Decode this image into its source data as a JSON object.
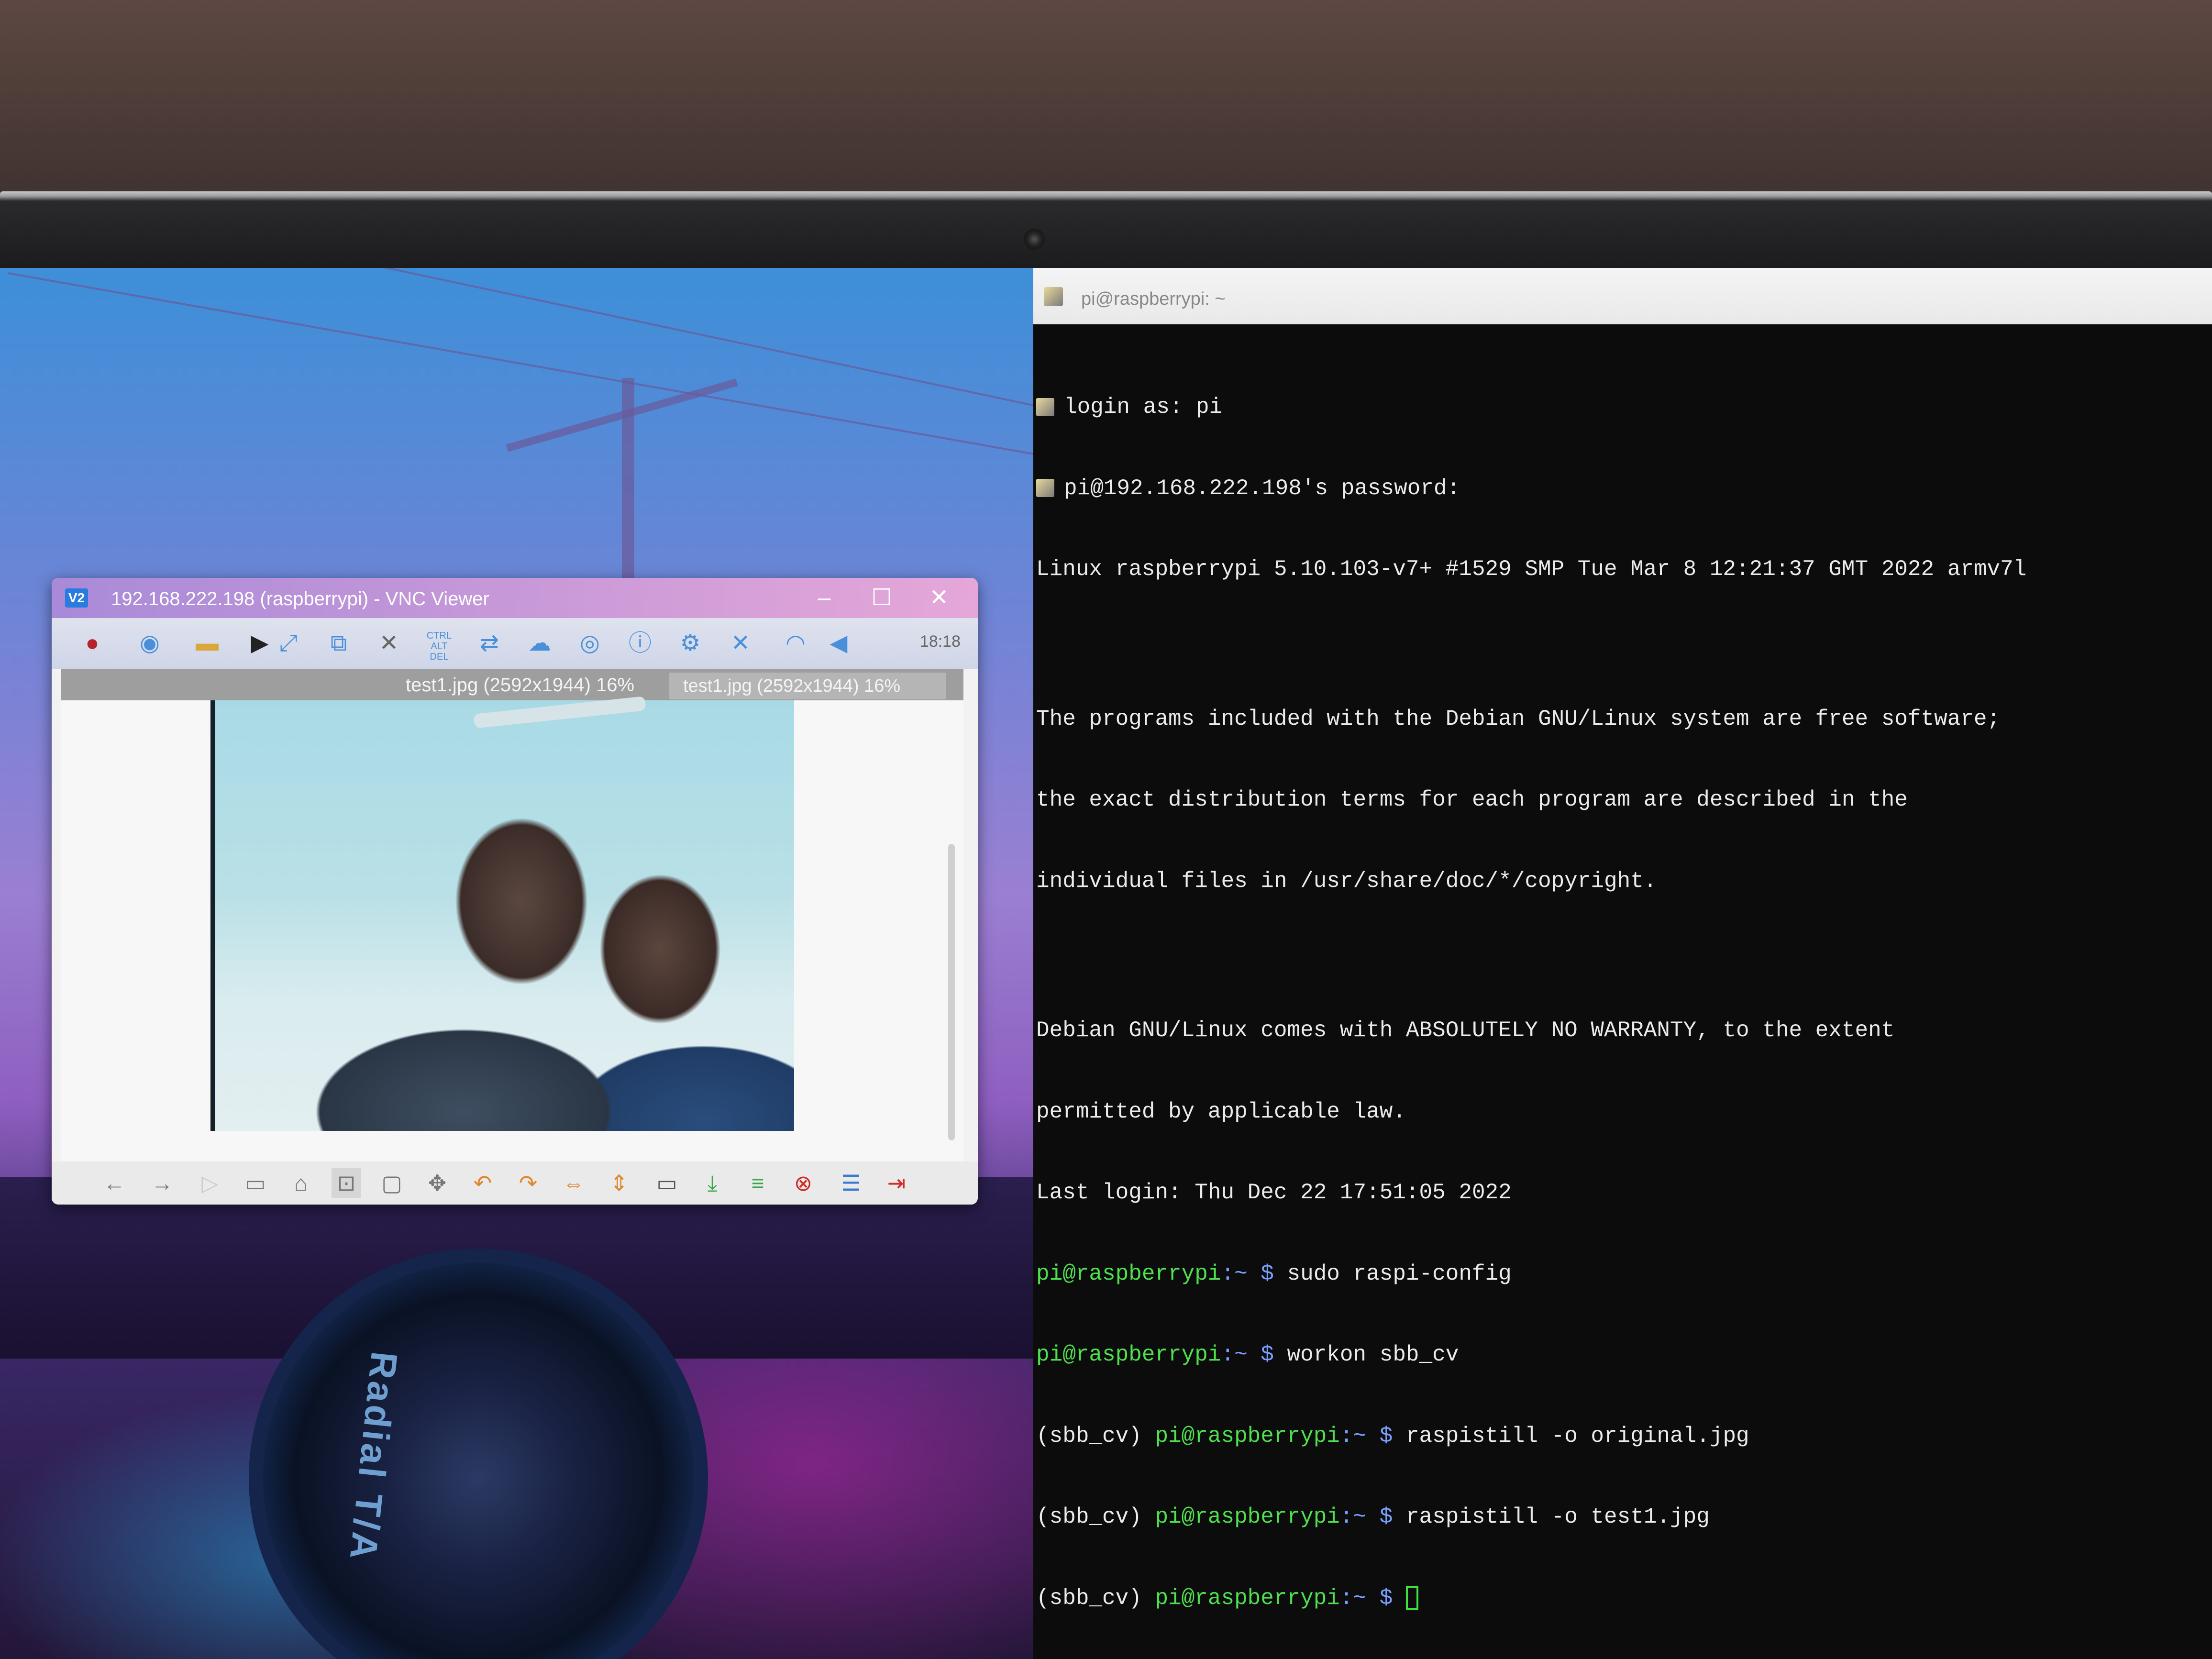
{
  "vnc_viewer": {
    "title": "192.168.222.198 (raspberrypi) - VNC Viewer",
    "logo": "V2",
    "minimize": "–",
    "maximize": "☐",
    "close": "✕",
    "toolbar": {
      "icons": [
        "raspberry-menu-icon",
        "browser-globe-icon",
        "file-manager-icon",
        "terminal-icon",
        "fullscreen-icon",
        "scale-icon",
        "mute-icon",
        "ctrl-alt-del-icon",
        "transfer-icon",
        "chat-icon",
        "record-icon",
        "info-icon",
        "settings-icon",
        "close-session-icon",
        "wifi-icon",
        "volume-icon"
      ],
      "ctrl_alt_del": "CTRL ALT DEL",
      "clock": "18:18"
    },
    "image_viewer": {
      "tab_title": "test1.jpg (2592x1944) 16%",
      "tooltip": "test1.jpg (2592x1944) 16%",
      "bottom_icons": [
        "back-arrow-icon",
        "forward-arrow-icon",
        "play-icon",
        "zoom-out-icon",
        "zoom-in-icon",
        "fit-icon",
        "original-size-icon",
        "fullscreen-move-icon",
        "rotate-left-icon",
        "rotate-right-icon",
        "flip-horizontal-icon",
        "flip-vertical-icon",
        "open-icon",
        "save-icon",
        "save-as-icon",
        "delete-icon",
        "preferences-icon",
        "exit-icon"
      ]
    }
  },
  "putty": {
    "title": "pi@raspberrypi: ~",
    "lines": {
      "l1": "login as: pi",
      "l2": "pi@192.168.222.198's password:",
      "l3": "Linux raspberrypi 5.10.103-v7+ #1529 SMP Tue Mar 8 12:21:37 GMT 2022 armv7l",
      "l4": "The programs included with the Debian GNU/Linux system are free software;",
      "l5": "the exact distribution terms for each program are described in the",
      "l6": "individual files in /usr/share/doc/*/copyright.",
      "l7": "Debian GNU/Linux comes with ABSOLUTELY NO WARRANTY, to the extent",
      "l8": "permitted by applicable law.",
      "l9": "Last login: Thu Dec 22 17:51:05 2022"
    },
    "prompt_user": "pi@raspberrypi",
    "prompt_path": ":~ $",
    "venv": "(sbb_cv) ",
    "commands": {
      "c1": " sudo raspi-config",
      "c2": " workon sbb_cv",
      "c3": " raspistill -o original.jpg",
      "c4": " raspistill -o test1.jpg"
    }
  },
  "wallpaper": {
    "tire_text": "Radial T/A"
  }
}
